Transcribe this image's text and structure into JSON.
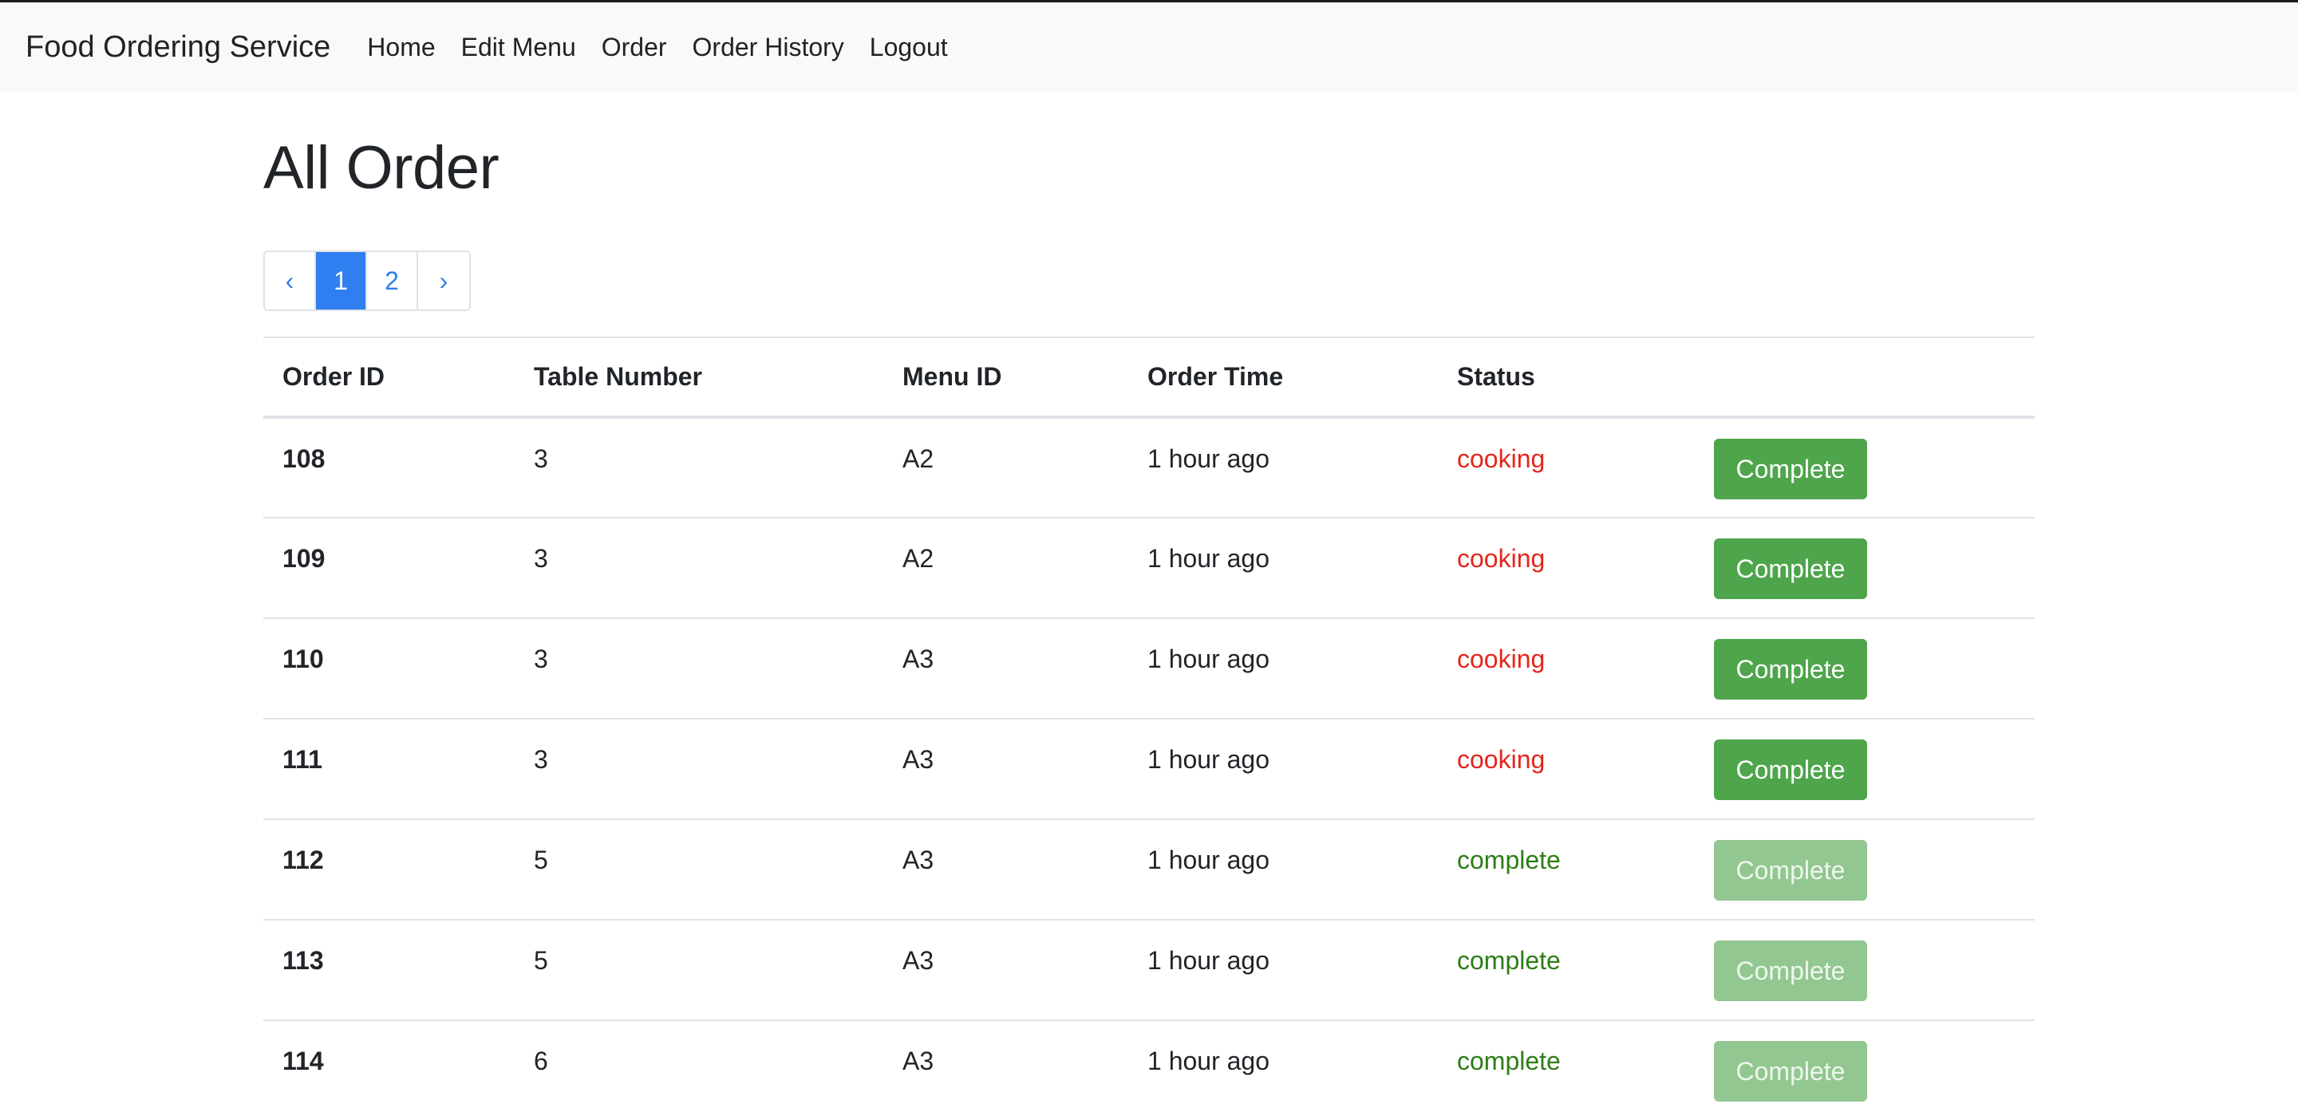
{
  "nav": {
    "brand": "Food Ordering Service",
    "links": [
      "Home",
      "Edit Menu",
      "Order",
      "Order History",
      "Logout"
    ]
  },
  "page": {
    "title": "All Order"
  },
  "pagination": {
    "prev": "‹",
    "pages": [
      "1",
      "2"
    ],
    "next": "›",
    "active_page": "1"
  },
  "table": {
    "headers": [
      "Order ID",
      "Table Number",
      "Menu ID",
      "Order Time",
      "Status",
      ""
    ],
    "rows": [
      {
        "id": "108",
        "table": "3",
        "menu": "A2",
        "time": "1 hour ago",
        "status": "cooking",
        "action": "Complete",
        "enabled": true
      },
      {
        "id": "109",
        "table": "3",
        "menu": "A2",
        "time": "1 hour ago",
        "status": "cooking",
        "action": "Complete",
        "enabled": true
      },
      {
        "id": "110",
        "table": "3",
        "menu": "A3",
        "time": "1 hour ago",
        "status": "cooking",
        "action": "Complete",
        "enabled": true
      },
      {
        "id": "111",
        "table": "3",
        "menu": "A3",
        "time": "1 hour ago",
        "status": "cooking",
        "action": "Complete",
        "enabled": true
      },
      {
        "id": "112",
        "table": "5",
        "menu": "A3",
        "time": "1 hour ago",
        "status": "complete",
        "action": "Complete",
        "enabled": false
      },
      {
        "id": "113",
        "table": "5",
        "menu": "A3",
        "time": "1 hour ago",
        "status": "complete",
        "action": "Complete",
        "enabled": false
      },
      {
        "id": "114",
        "table": "6",
        "menu": "A3",
        "time": "1 hour ago",
        "status": "complete",
        "action": "Complete",
        "enabled": false
      }
    ]
  },
  "colors": {
    "cooking": "#e3261b",
    "complete": "#2e7d16",
    "button": "#4ea54b",
    "button_disabled": "#93c791",
    "active_page": "#2f7ff0"
  }
}
